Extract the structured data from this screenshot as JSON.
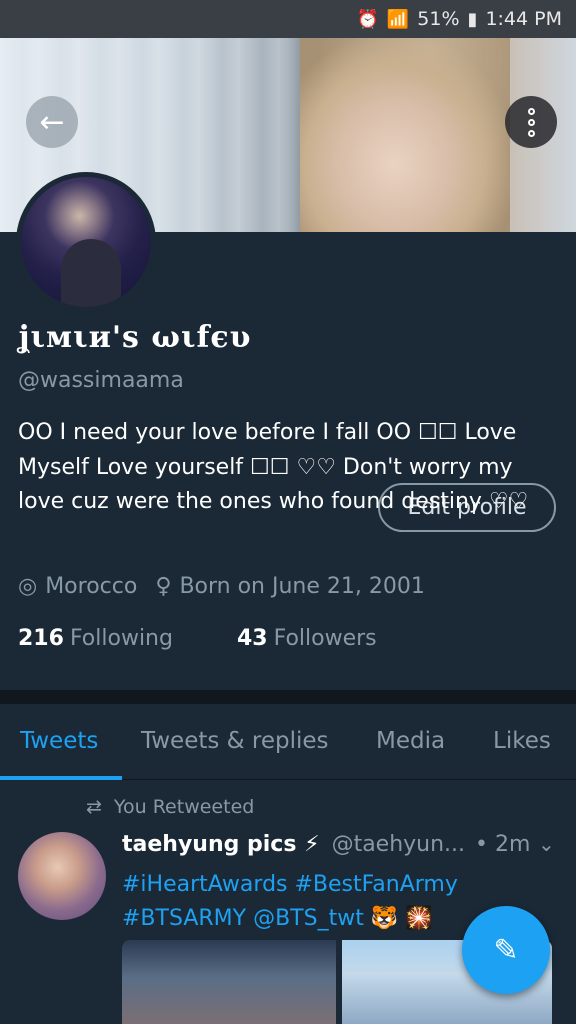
{
  "status_bar": {
    "battery": "51%",
    "time": "1:44 PM"
  },
  "profile": {
    "display_name": "ʝιмιи'ѕ ωιfєυ",
    "handle": "@wassimaama",
    "bio": "OO I need your love before I fall OO    ☐☐ Love Myself Love yourself ☐☐    ♡♡ Don't worry my love cuz were the ones who found destiny ♡♡",
    "location": "Morocco",
    "birthday": "Born on June 21, 2001",
    "following_count": "216",
    "following_label": "Following",
    "followers_count": "43",
    "followers_label": "Followers",
    "edit_label": "Edit profile"
  },
  "tabs": [
    {
      "label": "Tweets",
      "active": true
    },
    {
      "label": "Tweets & replies",
      "active": false
    },
    {
      "label": "Media",
      "active": false
    },
    {
      "label": "Likes",
      "active": false
    }
  ],
  "tweet": {
    "retweet_label": "You Retweeted",
    "author_name": "taehyung pics ⚡",
    "author_handle": "@taehyun...",
    "time": "• 2m",
    "text": "#iHeartAwards #BestFanArmy #BTSARMY @BTS_twt 🐯 🎇"
  },
  "colors": {
    "accent": "#1da1f2",
    "background": "#1b2836",
    "muted_text": "#8899a6"
  },
  "icons": {
    "back": "arrow-left-icon",
    "more": "vertical-dots-icon",
    "location": "pin-icon",
    "birthday": "balloon-icon",
    "retweet": "retweet-icon",
    "compose": "feather-plus-icon"
  }
}
